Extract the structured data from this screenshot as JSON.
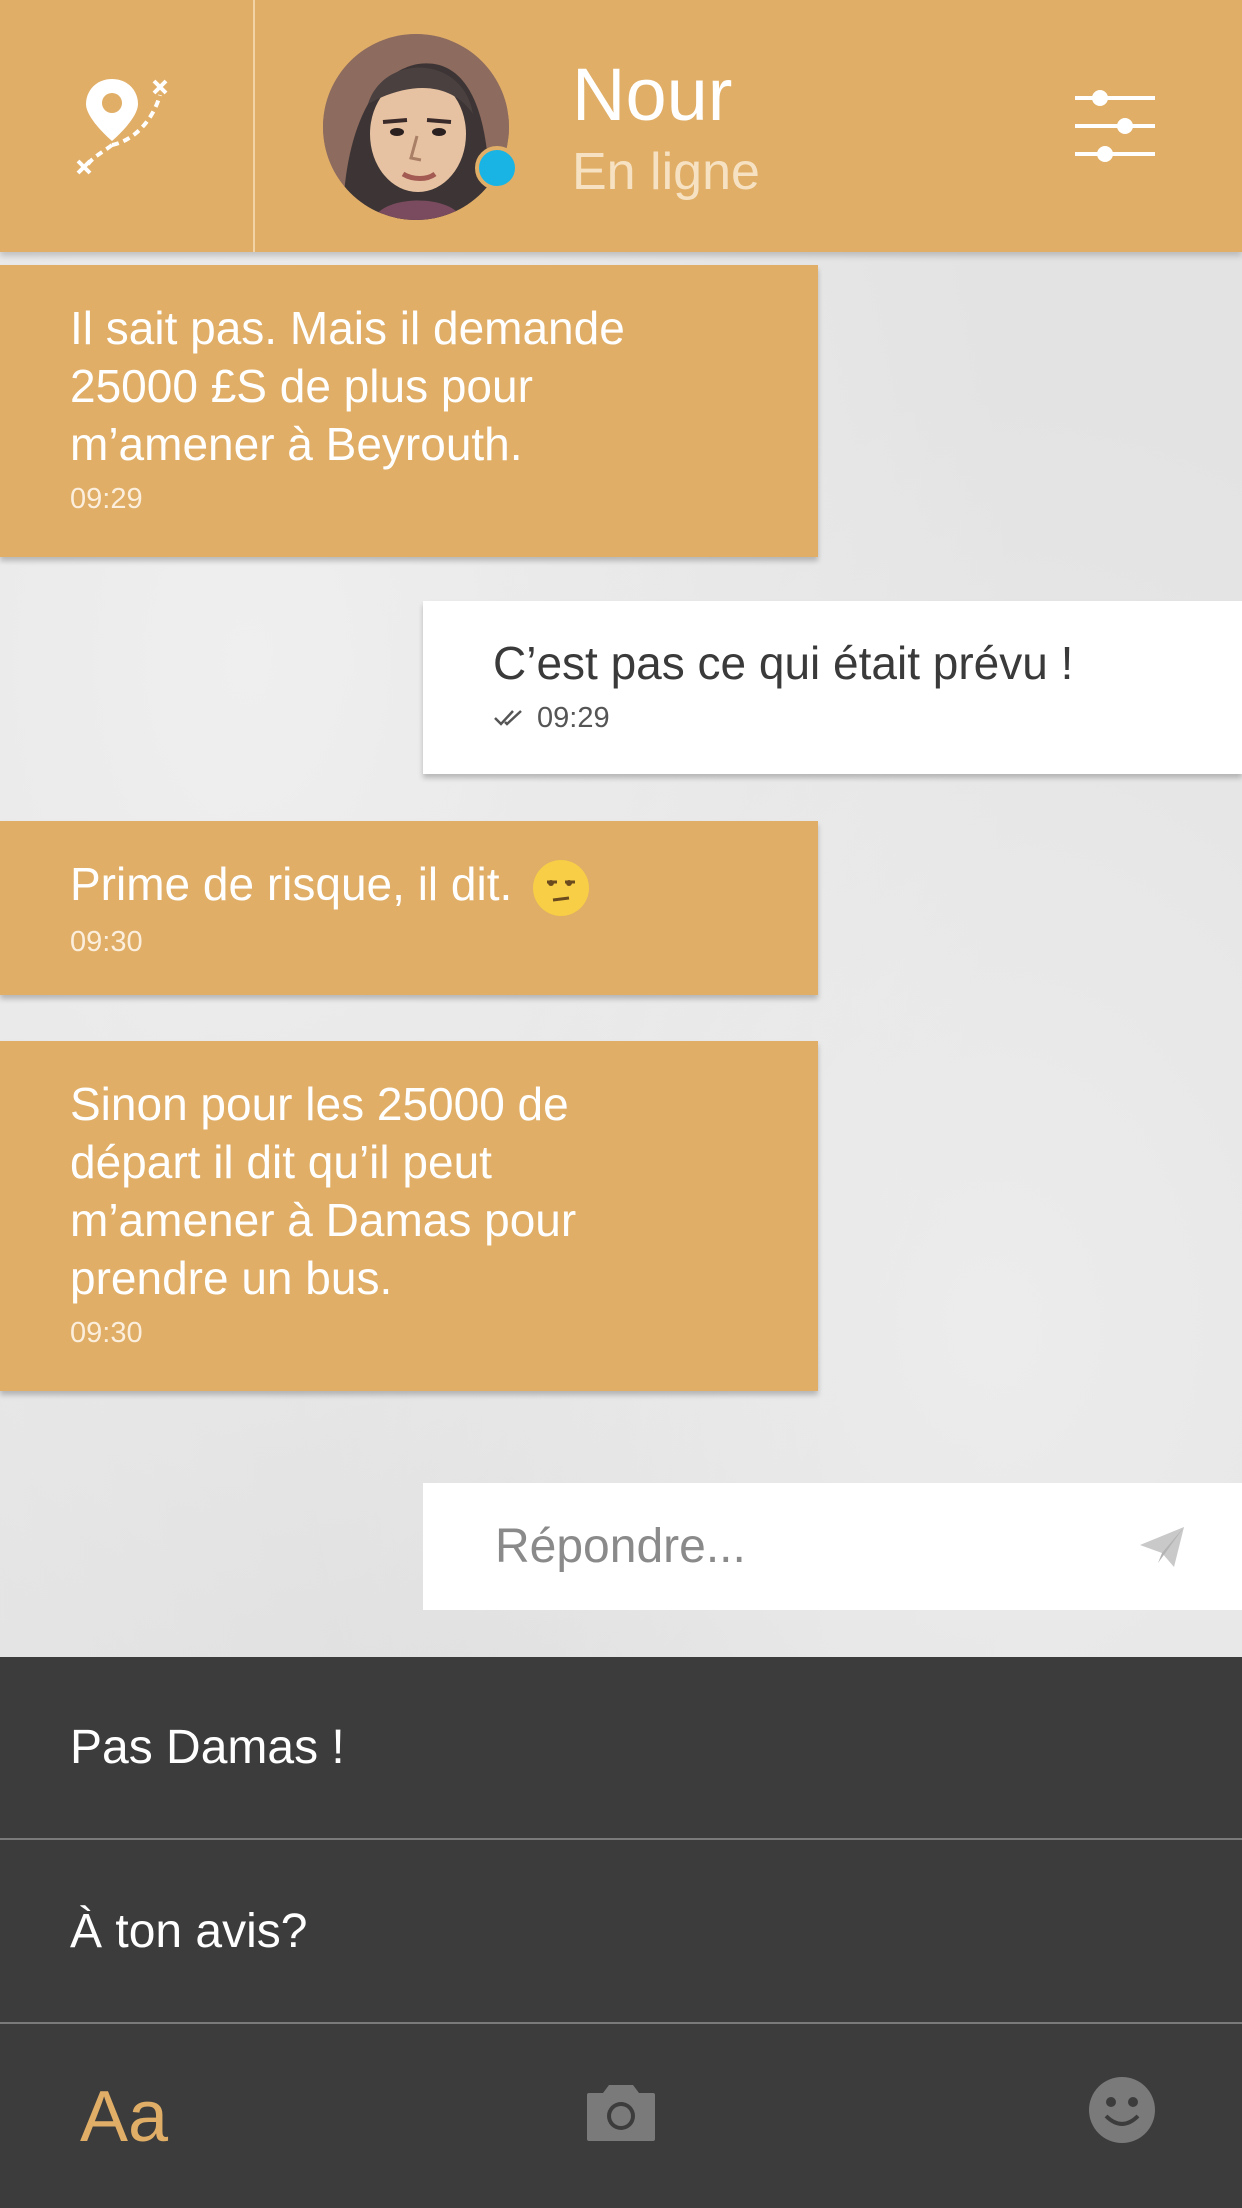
{
  "header": {
    "contact_name": "Nour",
    "status_text": "En ligne",
    "status_color": "#19b4e4",
    "map_icon": "map-route-icon",
    "settings_icon": "sliders-icon",
    "accent_color": "#e0ae66"
  },
  "messages": [
    {
      "direction": "in",
      "text": "Il sait pas. Mais il demande 25000 £S de plus pour m’amener à Beyrouth.",
      "time": "09:29"
    },
    {
      "direction": "out",
      "text": "C’est pas ce qui était prévu !",
      "time": "09:29",
      "receipt_icon": "double-check-icon"
    },
    {
      "direction": "in",
      "text": "Prime de risque, il dit.",
      "time": "09:30",
      "emoji": "unamused-face-emoji"
    },
    {
      "direction": "in",
      "text": "Sinon pour les 25000 de départ il dit qu’il peut m’amener à Damas pour prendre un bus.",
      "time": "09:30"
    }
  ],
  "reply": {
    "placeholder": "Répondre...",
    "send_icon": "paper-plane-icon"
  },
  "choices": [
    {
      "label": "Pas Damas !"
    },
    {
      "label": "À ton avis?"
    }
  ],
  "toolbar": {
    "text_label": "Aa",
    "camera_icon": "camera-icon",
    "emoji_icon": "smiley-icon"
  }
}
